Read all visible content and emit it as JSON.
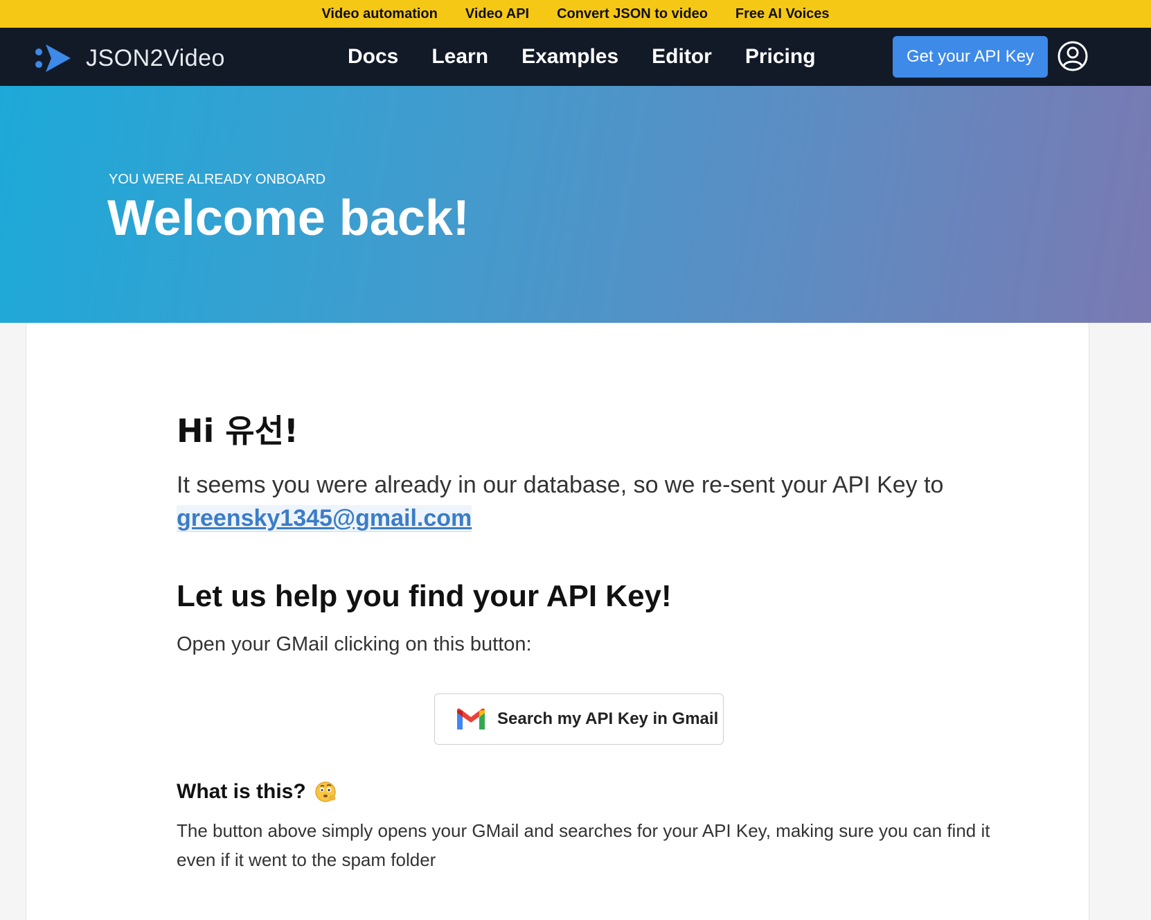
{
  "topbar": {
    "links": [
      "Video automation",
      "Video API",
      "Convert JSON to video",
      "Free AI Voices"
    ]
  },
  "nav": {
    "brand": "JSON2Video",
    "links": [
      "Docs",
      "Learn",
      "Examples",
      "Editor",
      "Pricing"
    ],
    "cta": "Get your API Key",
    "user_icon": "user-circle-icon"
  },
  "hero": {
    "kicker": "YOU WERE ALREADY ONBOARD",
    "title": "Welcome back!"
  },
  "content": {
    "greeting": "Hi 유선!",
    "lead_text": "It seems you were already in our database, so we re-sent your API Key to",
    "email": "greensky1345@gmail.com",
    "help_title": "Let us help you find your API Key!",
    "help_sub": "Open your GMail clicking on this button:",
    "gmail_button": "Search my API Key in Gmail",
    "what_title": "What is this?",
    "what_text": "The button above simply opens your GMail and searches for your API Key, making sure you can find it even if it went to the spam folder"
  },
  "colors": {
    "topbar": "#f6c816",
    "navbar": "#121a28",
    "accent": "#3d8ae8",
    "link": "#3b7cc7"
  }
}
